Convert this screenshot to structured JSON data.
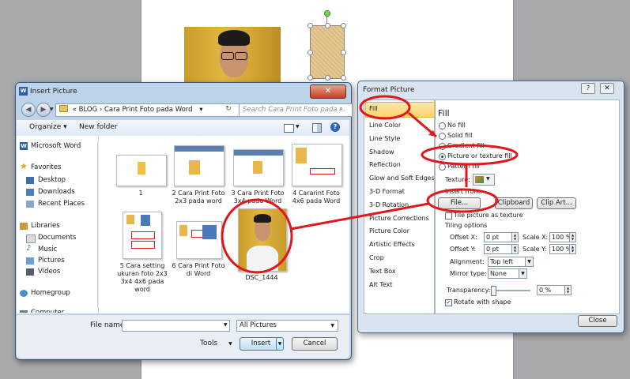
{
  "insert_picture": {
    "title": "Insert Picture",
    "breadcrumb": [
      "«",
      "BLOG",
      "›",
      "Cara Print Foto pada Word",
      "▾"
    ],
    "search_placeholder": "Search Cara Print Foto pada ...",
    "toolbar": {
      "organize": "Organize ▾",
      "new_folder": "New folder"
    },
    "nav": {
      "microsoft_word": "Microsoft Word",
      "favorites": "Favorites",
      "desktop": "Desktop",
      "downloads": "Downloads",
      "recent_places": "Recent Places",
      "libraries": "Libraries",
      "documents": "Documents",
      "music": "Music",
      "pictures": "Pictures",
      "videos": "Videos",
      "homegroup": "Homegroup",
      "computer": "Computer"
    },
    "files": [
      {
        "name": "1"
      },
      {
        "name": "2 Cara Print Foto 2x3 pada word"
      },
      {
        "name": "3 Cara Print Foto 3x4 pada Word"
      },
      {
        "name": "4 Cararint Foto 4x6 pada Word"
      },
      {
        "name": "5 Cara setting ukuran foto 2x3 3x4 4x6 pada word"
      },
      {
        "name": "6 Cara Print Foto di Word"
      },
      {
        "name": "DSC_1444"
      }
    ],
    "file_name_label": "File name:",
    "file_name_value": "",
    "file_type": "All Pictures",
    "tools": "Tools",
    "insert": "Insert",
    "cancel": "Cancel"
  },
  "format_picture": {
    "title": "Format Picture",
    "help": "?",
    "categories": [
      "Fill",
      "Line Color",
      "Line Style",
      "Shadow",
      "Reflection",
      "Glow and Soft Edges",
      "3-D Format",
      "3-D Rotation",
      "Picture Corrections",
      "Picture Color",
      "Artistic Effects",
      "Crop",
      "Text Box",
      "Alt Text"
    ],
    "heading": "Fill",
    "fill_options": [
      "No fill",
      "Solid fill",
      "Gradient fill",
      "Picture or texture fill",
      "Pattern fill"
    ],
    "texture_label": "Texture:",
    "insert_from": "Insert from:",
    "file_btn": "File...",
    "clipboard_btn": "Clipboard",
    "clipart_btn": "Clip Art...",
    "tile_label": "Tile picture as texture",
    "tiling_options": "Tiling options",
    "offset_x_label": "Offset X:",
    "offset_x": "0 pt",
    "offset_y_label": "Offset Y:",
    "offset_y": "0 pt",
    "scale_x_label": "Scale X:",
    "scale_x": "100 %",
    "scale_y_label": "Scale Y:",
    "scale_y": "100 %",
    "alignment_label": "Alignment:",
    "alignment": "Top left",
    "mirror_label": "Mirror type:",
    "mirror": "None",
    "transparency_label": "Transparency:",
    "transparency": "0 %",
    "rotate_label": "Rotate with shape",
    "close": "Close"
  },
  "colors": {
    "highlight": "#e0181b",
    "selected_tab": "#fcd46a"
  }
}
